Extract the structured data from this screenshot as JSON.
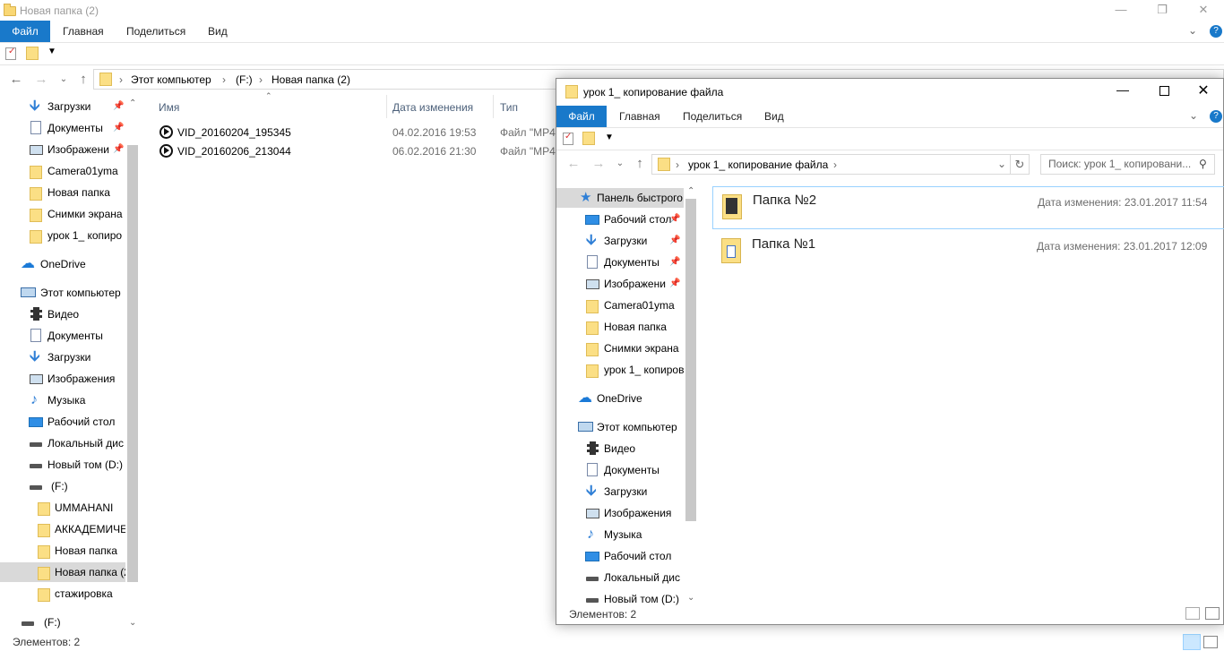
{
  "background_window": {
    "title": "Новая папка (2)",
    "ribbon_tabs": [
      "Файл",
      "Главная",
      "Поделиться",
      "Вид"
    ],
    "breadcrumbs": [
      "Этот компьютер",
      "(F:)",
      "Новая папка (2)"
    ],
    "columns": [
      "Имя",
      "Дата изменения",
      "Тип"
    ],
    "files": [
      {
        "name": "VID_20160204_195345",
        "date": "04.02.2016 19:53",
        "type": "Файл \"MP4"
      },
      {
        "name": "VID_20160206_213044",
        "date": "06.02.2016 21:30",
        "type": "Файл \"MP4"
      }
    ],
    "quick_access": [
      {
        "label": "Загрузки",
        "icon": "download-icon",
        "pinned": true
      },
      {
        "label": "Документы",
        "icon": "document-icon",
        "pinned": true
      },
      {
        "label": "Изображени",
        "icon": "pictures-icon",
        "pinned": true
      },
      {
        "label": "Camera01yma",
        "icon": "folder-icon"
      },
      {
        "label": "Новая папка",
        "icon": "folder-icon"
      },
      {
        "label": "Снимки экрана",
        "icon": "folder-icon"
      },
      {
        "label": "урок 1_ копиро",
        "icon": "folder-icon"
      }
    ],
    "onedrive": "OneDrive",
    "this_pc": "Этот компьютер",
    "pc_items": [
      {
        "label": "Видео",
        "icon": "video-icon"
      },
      {
        "label": "Документы",
        "icon": "document-icon"
      },
      {
        "label": "Загрузки",
        "icon": "download-icon"
      },
      {
        "label": "Изображения",
        "icon": "pictures-icon"
      },
      {
        "label": "Музыка",
        "icon": "music-icon"
      },
      {
        "label": "Рабочий стол",
        "icon": "desktop-icon"
      },
      {
        "label": "Локальный дис",
        "icon": "drive-icon"
      },
      {
        "label": "Новый том (D:)",
        "icon": "drive-icon"
      },
      {
        "label": "(F:)",
        "icon": "drive-icon"
      }
    ],
    "f_folders": [
      "UMMAHANI",
      "АККАДЕМИЧЕ",
      "Новая папка",
      "Новая папка (2",
      "стажировка"
    ],
    "second_drive": "(F:)",
    "status": "Элементов: 2"
  },
  "foreground_window": {
    "title": "урок 1_ копирование файла",
    "ribbon_tabs": [
      "Файл",
      "Главная",
      "Поделиться",
      "Вид"
    ],
    "breadcrumb": "урок 1_ копирование файла",
    "search_placeholder": "Поиск: урок 1_ копировани...",
    "quick_access_label": "Панель быстрого",
    "quick_access": [
      {
        "label": "Рабочий стол",
        "icon": "desktop-icon",
        "pinned": true
      },
      {
        "label": "Загрузки",
        "icon": "download-icon",
        "pinned": true
      },
      {
        "label": "Документы",
        "icon": "document-icon",
        "pinned": true
      },
      {
        "label": "Изображени",
        "icon": "pictures-icon",
        "pinned": true
      },
      {
        "label": "Camera01yma",
        "icon": "folder-icon"
      },
      {
        "label": "Новая папка",
        "icon": "folder-icon"
      },
      {
        "label": "Снимки экрана",
        "icon": "folder-icon"
      },
      {
        "label": "урок 1_ копиров",
        "icon": "folder-icon"
      }
    ],
    "onedrive": "OneDrive",
    "this_pc": "Этот компьютер",
    "pc_items": [
      {
        "label": "Видео",
        "icon": "video-icon"
      },
      {
        "label": "Документы",
        "icon": "document-icon"
      },
      {
        "label": "Загрузки",
        "icon": "download-icon"
      },
      {
        "label": "Изображения",
        "icon": "pictures-icon"
      },
      {
        "label": "Музыка",
        "icon": "music-icon"
      },
      {
        "label": "Рабочий стол",
        "icon": "desktop-icon"
      },
      {
        "label": "Локальный дис",
        "icon": "drive-icon"
      },
      {
        "label": "Новый том (D:)",
        "icon": "drive-icon"
      }
    ],
    "folders": [
      {
        "name": "Папка №2",
        "meta": "Дата изменения: 23.01.2017 11:54"
      },
      {
        "name": "Папка №1",
        "meta": "Дата изменения: 23.01.2017 12:09"
      }
    ],
    "status": "Элементов: 2"
  },
  "colors": {
    "accent": "#1979ca",
    "selection": "#cce8ff",
    "folder": "#fbdf85"
  }
}
